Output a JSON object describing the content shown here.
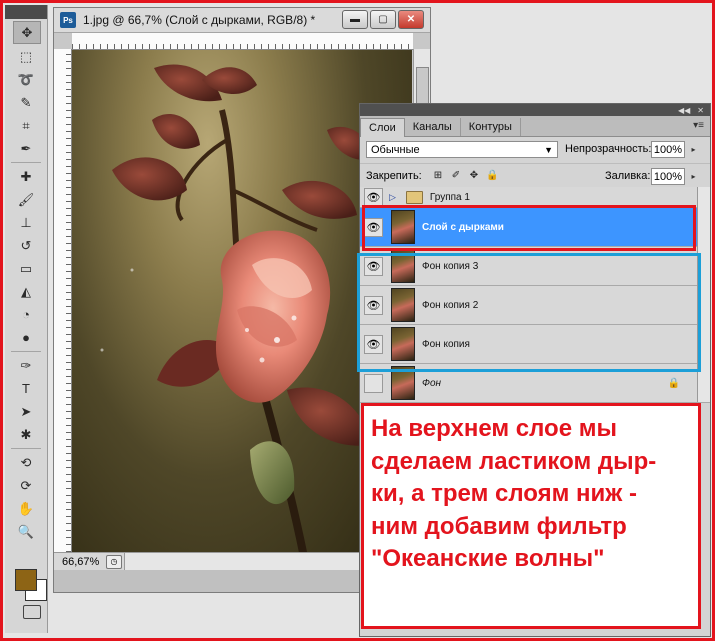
{
  "document": {
    "title": "1.jpg @ 66,7% (Слой с дырками, RGB/8) *",
    "app_badge": "Ps",
    "zoom": "66,67%"
  },
  "layers_panel": {
    "tabs": [
      "Слои",
      "Каналы",
      "Контуры"
    ],
    "active_tab": "Слои",
    "blend_mode": "Обычные",
    "opacity_label": "Непрозрачность:",
    "opacity_value": "100%",
    "lock_label": "Закрепить:",
    "fill_label": "Заливка:",
    "fill_value": "100%",
    "layers": [
      {
        "name": "Группа 1",
        "type": "group",
        "visible": true
      },
      {
        "name": "Слой с дырками",
        "type": "layer",
        "visible": true,
        "selected": true
      },
      {
        "name": "Фон копия 3",
        "type": "layer",
        "visible": true
      },
      {
        "name": "Фон копия 2",
        "type": "layer",
        "visible": true
      },
      {
        "name": "Фон копия",
        "type": "layer",
        "visible": true
      },
      {
        "name": "Фон",
        "type": "background",
        "visible": false,
        "locked": true
      }
    ]
  },
  "annotation": {
    "text": "На верхнем слое мы\nсделаем ластиком дыр-\nки, а трем слоям ниж -\nним добавим  фильтр\n \"Океанские волны\""
  },
  "colors": {
    "annotation_red": "#e3141d",
    "highlight_blue": "#1c9fd8",
    "selected_layer": "#3d95ff",
    "foreground_swatch": "#8d6415",
    "background_swatch": "#ffffff"
  }
}
